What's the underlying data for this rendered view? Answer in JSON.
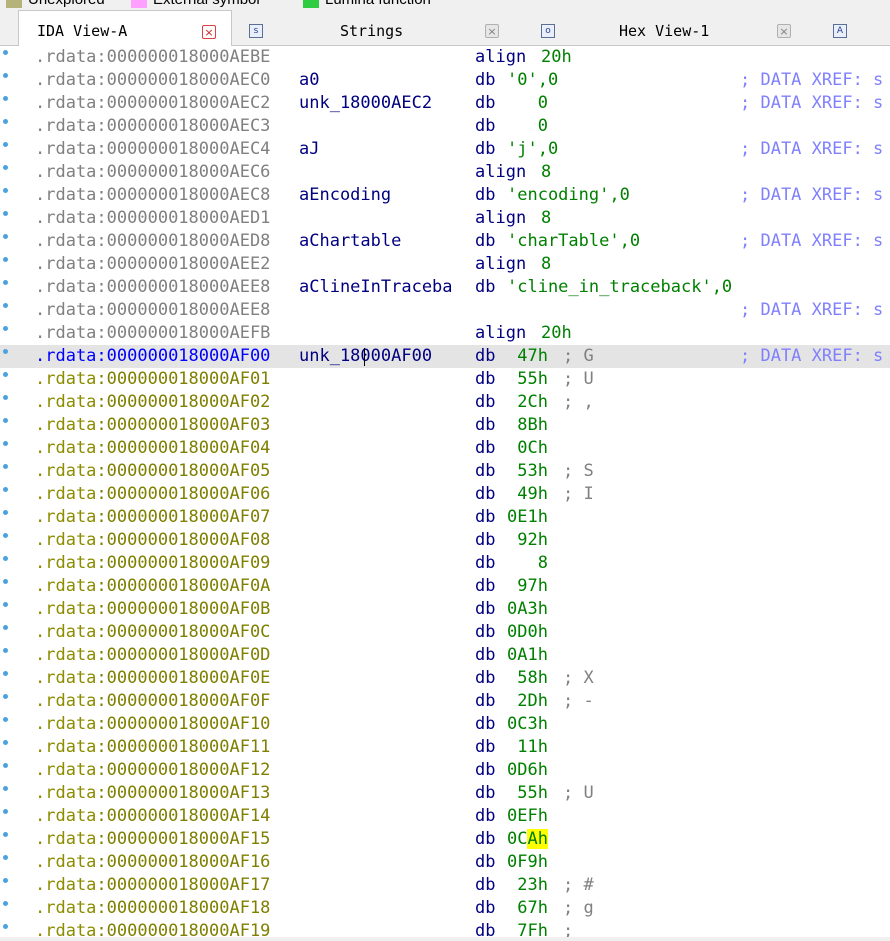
{
  "legend": [
    {
      "label": "Unexplored",
      "color": "#b5b37a"
    },
    {
      "label": "External symbol",
      "color": "#ff9fff"
    },
    {
      "label": "Lumina function",
      "color": "#2ecc40"
    }
  ],
  "tabs": [
    {
      "label": "IDA View-A",
      "active": true,
      "icon": "",
      "close": "red"
    },
    {
      "label": "Strings",
      "active": false,
      "icon": "s",
      "close": "gray"
    },
    {
      "label": "Hex View-1",
      "active": false,
      "icon": "o",
      "close": "gray"
    },
    {
      "label": "",
      "active": false,
      "icon": "A",
      "close": ""
    }
  ],
  "listing": {
    "segment": ".rdata",
    "rows": [
      {
        "off": ":000000018000AEBE",
        "name": "",
        "mnem": "align",
        "operand": "20h",
        "op_kind": "num",
        "cmt": "",
        "xref": ""
      },
      {
        "off": ":000000018000AEC0",
        "name": "a0",
        "mnem": "db",
        "operand": "'0',0",
        "op_kind": "str",
        "cmt": "",
        "xref": "; DATA XREF: s"
      },
      {
        "off": ":000000018000AEC2",
        "name": "unk_18000AEC2",
        "mnem": "db",
        "operand": "   0",
        "op_kind": "num",
        "cmt": "",
        "xref": "; DATA XREF: s"
      },
      {
        "off": ":000000018000AEC3",
        "name": "",
        "mnem": "db",
        "operand": "   0",
        "op_kind": "num",
        "cmt": "",
        "xref": ""
      },
      {
        "off": ":000000018000AEC4",
        "name": "aJ",
        "mnem": "db",
        "operand": "'j',0",
        "op_kind": "str",
        "cmt": "",
        "xref": "; DATA XREF: s"
      },
      {
        "off": ":000000018000AEC6",
        "name": "",
        "mnem": "align",
        "operand": "8",
        "op_kind": "num",
        "cmt": "",
        "xref": ""
      },
      {
        "off": ":000000018000AEC8",
        "name": "aEncoding",
        "mnem": "db",
        "operand": "'encoding',0",
        "op_kind": "str",
        "cmt": "",
        "xref": "; DATA XREF: s"
      },
      {
        "off": ":000000018000AED1",
        "name": "",
        "mnem": "align",
        "operand": "8",
        "op_kind": "num",
        "cmt": "",
        "xref": ""
      },
      {
        "off": ":000000018000AED8",
        "name": "aChartable",
        "mnem": "db",
        "operand": "'charTable',0",
        "op_kind": "str",
        "cmt": "",
        "xref": "; DATA XREF: s"
      },
      {
        "off": ":000000018000AEE2",
        "name": "",
        "mnem": "align",
        "operand": "8",
        "op_kind": "num",
        "cmt": "",
        "xref": ""
      },
      {
        "off": ":000000018000AEE8",
        "name": "aClineInTraceba",
        "mnem": "db",
        "operand": "'cline_in_traceback',0",
        "op_kind": "str",
        "cmt": "",
        "xref": ""
      },
      {
        "off": ":000000018000AEE8",
        "name": "",
        "mnem": "",
        "operand": "",
        "op_kind": "num",
        "cmt": "",
        "xref": "; DATA XREF: s"
      },
      {
        "off": ":000000018000AEFB",
        "name": "",
        "mnem": "align",
        "operand": "20h",
        "op_kind": "num",
        "cmt": "",
        "xref": ""
      },
      {
        "off": ":000000018000AF00",
        "name": "unk_18000AF00",
        "mnem": "db",
        "operand": " 47h",
        "op_kind": "num",
        "cmt": "; G",
        "xref": "; DATA XREF: s",
        "current": true
      },
      {
        "off": ":000000018000AF01",
        "name": "",
        "mnem": "db",
        "operand": " 55h",
        "op_kind": "num",
        "cmt": "; U",
        "xref": ""
      },
      {
        "off": ":000000018000AF02",
        "name": "",
        "mnem": "db",
        "operand": " 2Ch",
        "op_kind": "num",
        "cmt": "; ,",
        "xref": ""
      },
      {
        "off": ":000000018000AF03",
        "name": "",
        "mnem": "db",
        "operand": " 8Bh",
        "op_kind": "num",
        "cmt": "",
        "xref": ""
      },
      {
        "off": ":000000018000AF04",
        "name": "",
        "mnem": "db",
        "operand": " 0Ch",
        "op_kind": "num",
        "cmt": "",
        "xref": ""
      },
      {
        "off": ":000000018000AF05",
        "name": "",
        "mnem": "db",
        "operand": " 53h",
        "op_kind": "num",
        "cmt": "; S",
        "xref": ""
      },
      {
        "off": ":000000018000AF06",
        "name": "",
        "mnem": "db",
        "operand": " 49h",
        "op_kind": "num",
        "cmt": "; I",
        "xref": ""
      },
      {
        "off": ":000000018000AF07",
        "name": "",
        "mnem": "db",
        "operand": "0E1h",
        "op_kind": "num",
        "cmt": "",
        "xref": ""
      },
      {
        "off": ":000000018000AF08",
        "name": "",
        "mnem": "db",
        "operand": " 92h",
        "op_kind": "num",
        "cmt": "",
        "xref": ""
      },
      {
        "off": ":000000018000AF09",
        "name": "",
        "mnem": "db",
        "operand": "   8",
        "op_kind": "num",
        "cmt": "",
        "xref": ""
      },
      {
        "off": ":000000018000AF0A",
        "name": "",
        "mnem": "db",
        "operand": " 97h",
        "op_kind": "num",
        "cmt": "",
        "xref": ""
      },
      {
        "off": ":000000018000AF0B",
        "name": "",
        "mnem": "db",
        "operand": "0A3h",
        "op_kind": "num",
        "cmt": "",
        "xref": ""
      },
      {
        "off": ":000000018000AF0C",
        "name": "",
        "mnem": "db",
        "operand": "0D0h",
        "op_kind": "num",
        "cmt": "",
        "xref": ""
      },
      {
        "off": ":000000018000AF0D",
        "name": "",
        "mnem": "db",
        "operand": "0A1h",
        "op_kind": "num",
        "cmt": "",
        "xref": ""
      },
      {
        "off": ":000000018000AF0E",
        "name": "",
        "mnem": "db",
        "operand": " 58h",
        "op_kind": "num",
        "cmt": "; X",
        "xref": ""
      },
      {
        "off": ":000000018000AF0F",
        "name": "",
        "mnem": "db",
        "operand": " 2Dh",
        "op_kind": "num",
        "cmt": "; -",
        "xref": ""
      },
      {
        "off": ":000000018000AF10",
        "name": "",
        "mnem": "db",
        "operand": "0C3h",
        "op_kind": "num",
        "cmt": "",
        "xref": ""
      },
      {
        "off": ":000000018000AF11",
        "name": "",
        "mnem": "db",
        "operand": " 11h",
        "op_kind": "num",
        "cmt": "",
        "xref": ""
      },
      {
        "off": ":000000018000AF12",
        "name": "",
        "mnem": "db",
        "operand": "0D6h",
        "op_kind": "num",
        "cmt": "",
        "xref": ""
      },
      {
        "off": ":000000018000AF13",
        "name": "",
        "mnem": "db",
        "operand": " 55h",
        "op_kind": "num",
        "cmt": "; U",
        "xref": ""
      },
      {
        "off": ":000000018000AF14",
        "name": "",
        "mnem": "db",
        "operand": "0EFh",
        "op_kind": "num",
        "cmt": "",
        "xref": ""
      },
      {
        "off": ":000000018000AF15",
        "name": "",
        "mnem": "db",
        "operand": "0CAh",
        "op_kind": "num",
        "cmt": "",
        "xref": "",
        "highlight": "Ah"
      },
      {
        "off": ":000000018000AF16",
        "name": "",
        "mnem": "db",
        "operand": "0F9h",
        "op_kind": "num",
        "cmt": "",
        "xref": ""
      },
      {
        "off": ":000000018000AF17",
        "name": "",
        "mnem": "db",
        "operand": " 23h",
        "op_kind": "num",
        "cmt": "; #",
        "xref": ""
      },
      {
        "off": ":000000018000AF18",
        "name": "",
        "mnem": "db",
        "operand": " 67h",
        "op_kind": "num",
        "cmt": "; g",
        "xref": ""
      },
      {
        "off": ":000000018000AF19",
        "name": "",
        "mnem": "db",
        "operand": " 7Fh",
        "op_kind": "num",
        "cmt": ";",
        "xref": ""
      }
    ]
  },
  "colors": {
    "gutter_dot": "#4aa3e0",
    "xref": "#8080ff",
    "operand": "#008000",
    "mnemonic": "#000080",
    "highlight": "#ffff00"
  }
}
